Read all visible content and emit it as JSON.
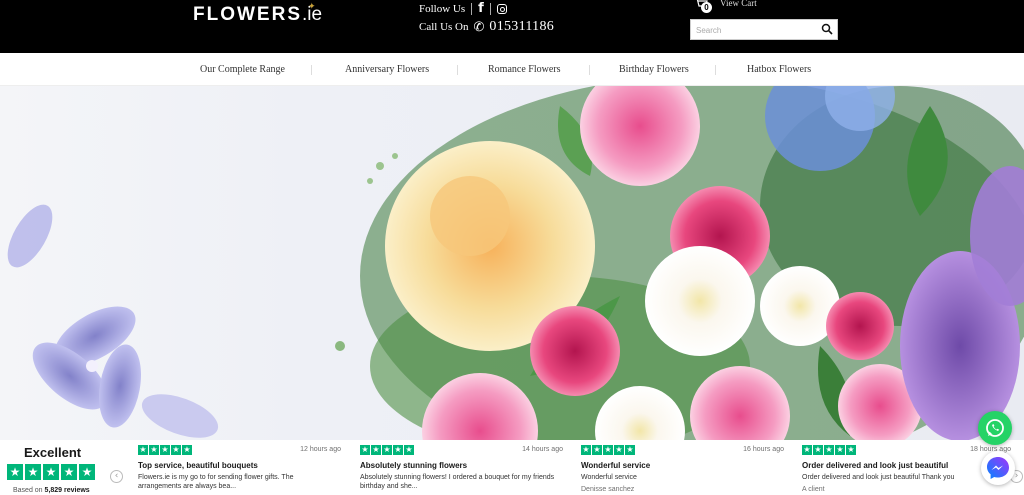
{
  "header": {
    "logo_main": "FLOWERS",
    "logo_tld": ".ie",
    "follow_label": "Follow Us",
    "call_label": "Call Us On",
    "phone": "015311186",
    "cart_count": "0",
    "cart_label": "View Cart",
    "search_placeholder": "Search"
  },
  "nav": {
    "items": [
      {
        "label": "Our Complete Range"
      },
      {
        "label": "Anniversary Flowers"
      },
      {
        "label": "Romance Flowers"
      },
      {
        "label": "Birthday Flowers"
      },
      {
        "label": "Hatbox Flowers"
      }
    ]
  },
  "trustpilot": {
    "rating_label": "Excellent",
    "based_on_prefix": "Based on",
    "review_count": "5,829 reviews",
    "reviews": [
      {
        "stars": 5,
        "time": "12 hours ago",
        "title": "Top service, beautiful bouquets",
        "body": "Flowers.ie is my go to for sending flower gifts. The arrangements are always bea...",
        "author": ""
      },
      {
        "stars": 5,
        "time": "14 hours ago",
        "title": "Absolutely stunning flowers",
        "body": "Absolutely stunning flowers! I ordered a bouquet for my friends birthday and she...",
        "author": ""
      },
      {
        "stars": 5,
        "time": "16 hours ago",
        "title": "Wonderful service",
        "body": "Wonderful service",
        "author": "Denisse sanchez"
      },
      {
        "stars": 5,
        "time": "18 hours ago",
        "title": "Order delivered and look just beautiful",
        "body": "Order delivered and look just beautiful Thank you",
        "author": "A client"
      }
    ]
  },
  "colors": {
    "header_bg": "#000000",
    "trustpilot_green": "#00b67a",
    "whatsapp_green": "#25d366",
    "messenger_blue": "#0084ff"
  },
  "icons": {
    "facebook": "facebook-icon",
    "instagram": "instagram-icon",
    "phone": "phone-icon",
    "cart": "cart-icon",
    "search": "search-icon",
    "whatsapp": "whatsapp-icon",
    "messenger": "messenger-icon"
  }
}
